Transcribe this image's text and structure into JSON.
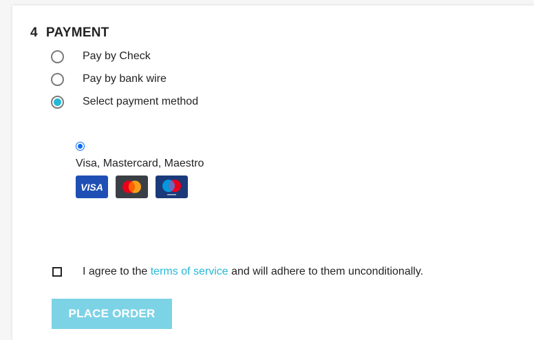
{
  "step": {
    "number": "4",
    "title": "PAYMENT"
  },
  "payment_options": [
    {
      "label": "Pay by Check",
      "selected": false
    },
    {
      "label": "Pay by bank wire",
      "selected": false
    },
    {
      "label": "Select payment method",
      "selected": true
    }
  ],
  "sub_method": {
    "label": "Visa, Mastercard, Maestro",
    "selected": true,
    "cards": [
      {
        "name": "visa-icon",
        "text": "VISA"
      },
      {
        "name": "mastercard-icon"
      },
      {
        "name": "maestro-icon"
      }
    ]
  },
  "terms": {
    "prefix": "I agree to the ",
    "link": "terms of service",
    "suffix": " and will adhere to them unconditionally."
  },
  "place_order_label": "PLACE ORDER",
  "colors": {
    "accent": "#24b9d7",
    "button_disabled": "#7dd3e6",
    "radio_blue": "#0b6cf7",
    "visa_blue": "#1f4fb5",
    "mastercard_bg": "#3a3f45",
    "maestro_bg": "#1b3a7a"
  }
}
